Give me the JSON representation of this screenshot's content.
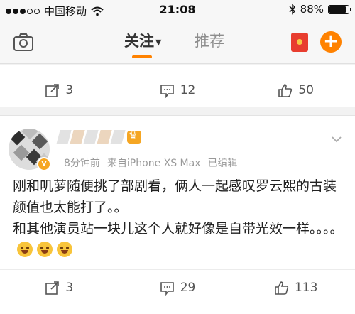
{
  "status_bar": {
    "carrier": "中国移动",
    "time": "21:08",
    "battery": "88%",
    "battery_level": 0.88
  },
  "nav": {
    "tab_follow": "关注",
    "tab_recommend": "推荐",
    "accent_color": "#ff8200"
  },
  "prev_post": {
    "reposts": "3",
    "comments": "12",
    "likes": "50"
  },
  "post": {
    "time": "8分钟前",
    "source": "来自iPhone XS Max",
    "edited": "已编辑",
    "line1": "刚和叽萝随便挑了部剧看，俩人一起感叹罗云熙的古装颜值也太能打了。。",
    "line2": "和其他演员站一块儿这个人就好像是自带光效一样。。。。",
    "reposts": "3",
    "comments": "29",
    "likes": "113"
  },
  "icons": [
    "signal-icon",
    "wifi-icon",
    "bluetooth-icon",
    "battery-icon",
    "camera-icon",
    "red-packet-icon",
    "plus-icon",
    "repost-icon",
    "comment-icon",
    "like-icon",
    "chevron-down-icon",
    "laugh-cry-emoji"
  ]
}
